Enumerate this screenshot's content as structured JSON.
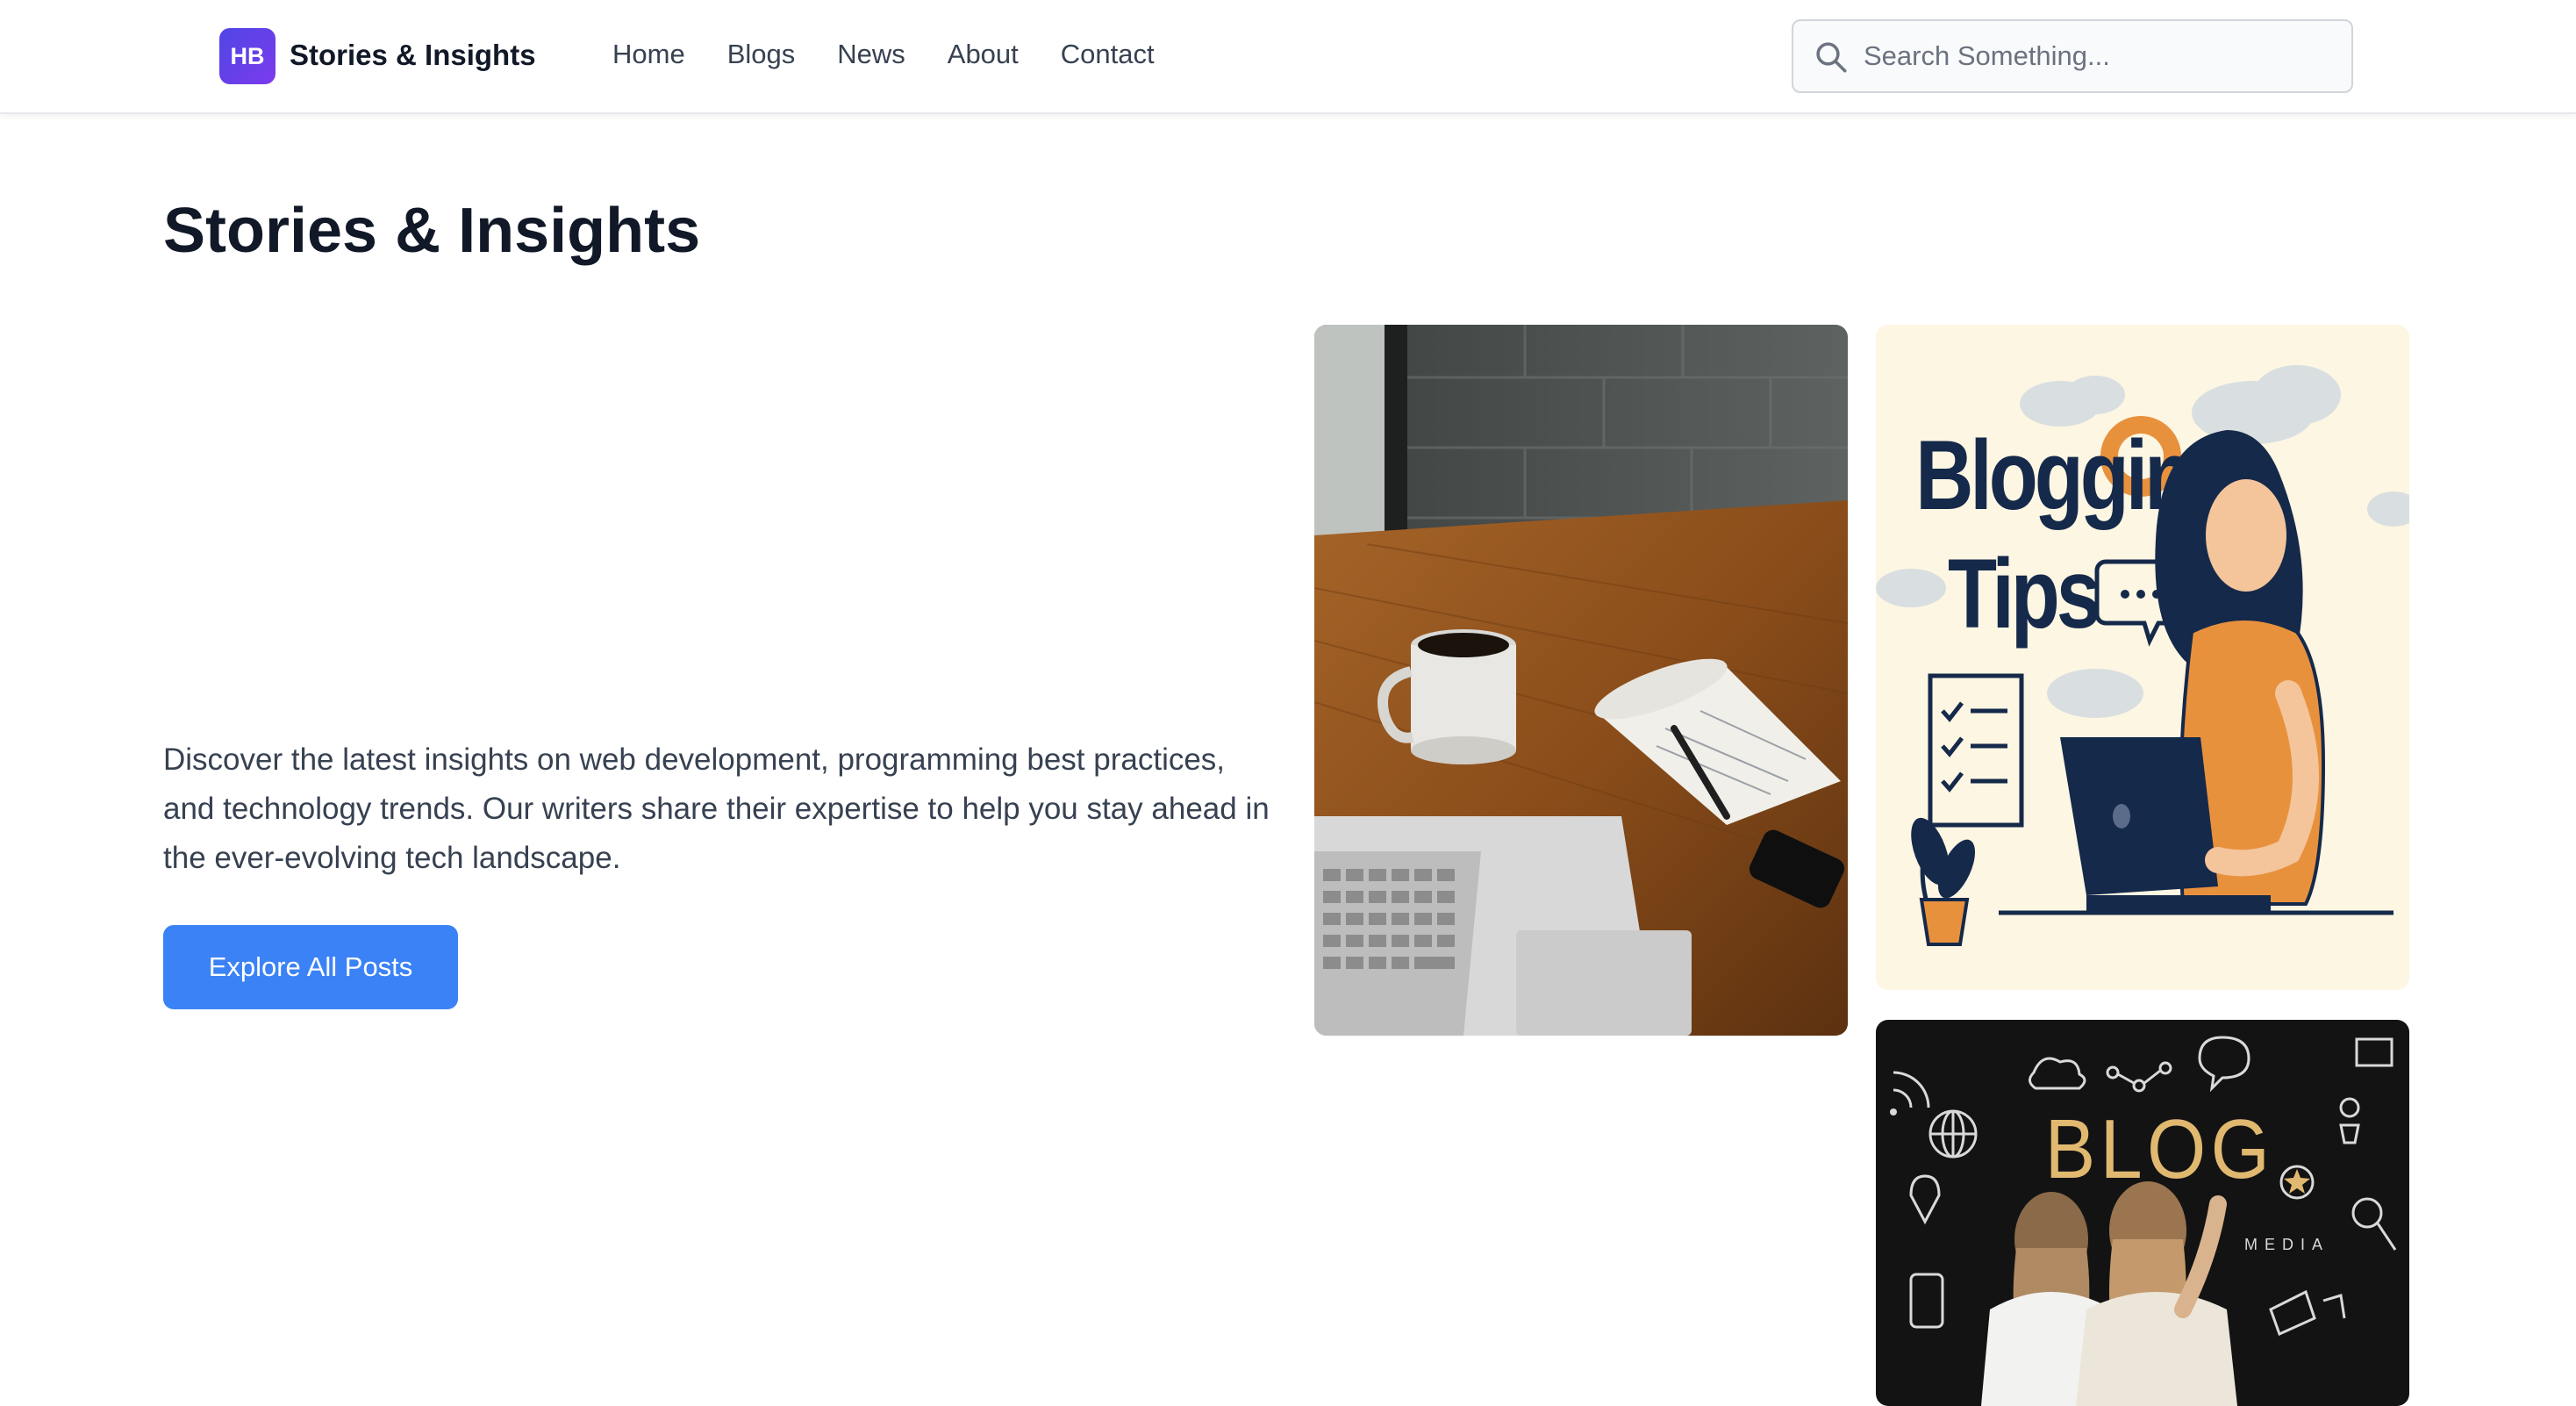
{
  "header": {
    "logo_initials": "HB",
    "brand_name": "Stories & Insights",
    "nav": [
      {
        "label": "Home"
      },
      {
        "label": "Blogs"
      },
      {
        "label": "News"
      },
      {
        "label": "About"
      },
      {
        "label": "Contact"
      }
    ],
    "search": {
      "placeholder": "Search Something...",
      "value": ""
    }
  },
  "hero": {
    "title": "Stories & Insights",
    "description": "Discover the latest insights on web development, programming best practices, and technology trends. Our writers share their expertise to help you stay ahead in the ever-evolving tech landscape.",
    "cta_label": "Explore All Posts"
  },
  "images": {
    "tips_line1": "Bloggin",
    "tips_line2": "Tips",
    "blog_word": "BLOG",
    "media_word": "MEDIA"
  },
  "colors": {
    "accent": "#3b82f6",
    "logo_gradient_start": "#4f46e5",
    "logo_gradient_end": "#7c3aed",
    "title": "#111827",
    "body_text": "#374151"
  },
  "icons": {
    "search": "search-icon"
  }
}
